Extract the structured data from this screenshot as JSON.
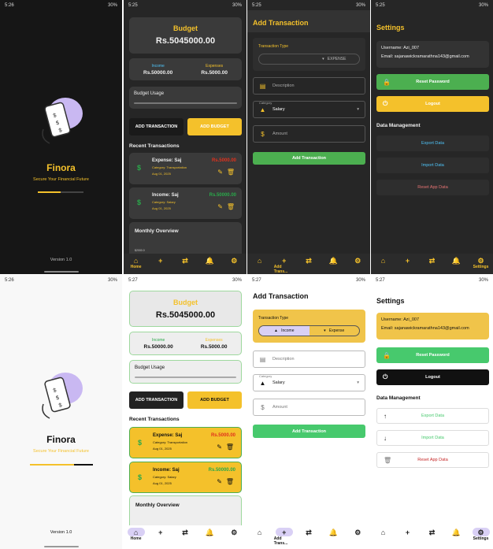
{
  "colors": {
    "accent": "#f4c12b",
    "income": "#2aa84a",
    "expense": "#e0311d",
    "green_button": "#4caf50",
    "dark_bg": "#1f1f1f",
    "light_bg": "#f8f8f8"
  },
  "status": {
    "time_top_left": "5:26",
    "time_home": "5:25",
    "time_add": "5:25",
    "time_settings": "5:25",
    "time_light_splash": "5:26",
    "time_light_home": "5:27",
    "time_light_add": "5:27",
    "time_light_settings": "5:27",
    "battery": "30%"
  },
  "splash": {
    "title": "Finora",
    "subtitle": "Secure Your Financial Future",
    "version": "Version 1.0"
  },
  "home": {
    "budget_label": "Budget",
    "budget_amount": "Rs.5045000.00",
    "income_label": "Income",
    "income_value": "Rs.50000.00",
    "expenses_label": "Expenses",
    "expenses_value": "Rs.5000.00",
    "usage_label": "Budget Usage",
    "add_transaction": "ADD TRANSACTION",
    "add_budget": "ADD BUDGET",
    "recent_title": "Recent Transactions",
    "transactions": [
      {
        "name": "Expense: Saj",
        "category": "Category: Transportation",
        "date": "Aug 01, 2025",
        "amount": "Rs.5000.00"
      },
      {
        "name": "Income: Saj",
        "category": "Category: Salary",
        "date": "Aug 01, 2025",
        "amount": "Rs.50000.00"
      }
    ],
    "overview_title": "Monthly Overview",
    "overview_axis": "$2000.0"
  },
  "add": {
    "title": "Add Transaction",
    "type_label": "Transaction Type",
    "income": "Income",
    "expense": "Expense",
    "dark_expense": "EXPENSE",
    "description_placeholder": "Description",
    "category_label": "Category",
    "category_value": "Salary",
    "amount_placeholder": "Amount",
    "submit": "Add Transaction"
  },
  "settings": {
    "title": "Settings",
    "username": "Username: Azi_007",
    "email": "Email: sajanawickramarathna143@gmail.com",
    "reset_password": "Reset Password",
    "logout": "Logout",
    "data_management": "Data Management",
    "export": "Export Data",
    "import": "Import Data",
    "reset_app": "Reset App Data"
  },
  "nav": {
    "home": "Home",
    "add": "Add Trans...",
    "settings": "Settings"
  },
  "icons": [
    "home-icon",
    "plus-icon",
    "swap-icon",
    "bell-icon",
    "gear-icon"
  ]
}
